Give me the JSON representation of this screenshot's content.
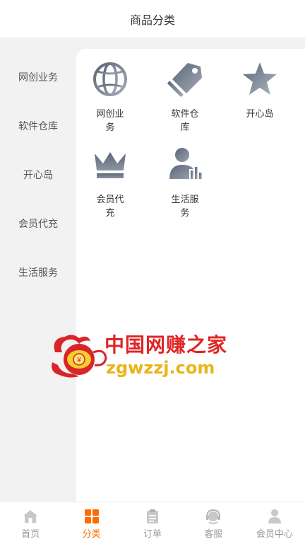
{
  "header": {
    "title": "商品分类"
  },
  "sidebar": {
    "items": [
      {
        "label": "网创业务"
      },
      {
        "label": "软件仓库"
      },
      {
        "label": "开心岛"
      },
      {
        "label": "会员代充"
      },
      {
        "label": "生活服务"
      }
    ]
  },
  "categories": [
    {
      "label": "网创业务",
      "icon": "globe-icon"
    },
    {
      "label": "软件仓库",
      "icon": "tag-icon"
    },
    {
      "label": "开心岛",
      "icon": "star-icon"
    },
    {
      "label": "会员代充",
      "icon": "crown-icon"
    },
    {
      "label": "生活服务",
      "icon": "user-chart-icon"
    }
  ],
  "watermark": {
    "cn": "中国网赚之家",
    "en": "zgwzzj.com"
  },
  "tabbar": {
    "items": [
      {
        "label": "首页",
        "icon": "home-icon"
      },
      {
        "label": "分类",
        "icon": "grid-icon",
        "active": true
      },
      {
        "label": "订单",
        "icon": "clipboard-icon"
      },
      {
        "label": "客服",
        "icon": "headset-icon"
      },
      {
        "label": "会员中心",
        "icon": "person-icon"
      }
    ]
  },
  "colors": {
    "accent": "#ff6b00",
    "icon_gray": "#6f7a8c",
    "sidebar_bg": "#f2f2f2"
  }
}
